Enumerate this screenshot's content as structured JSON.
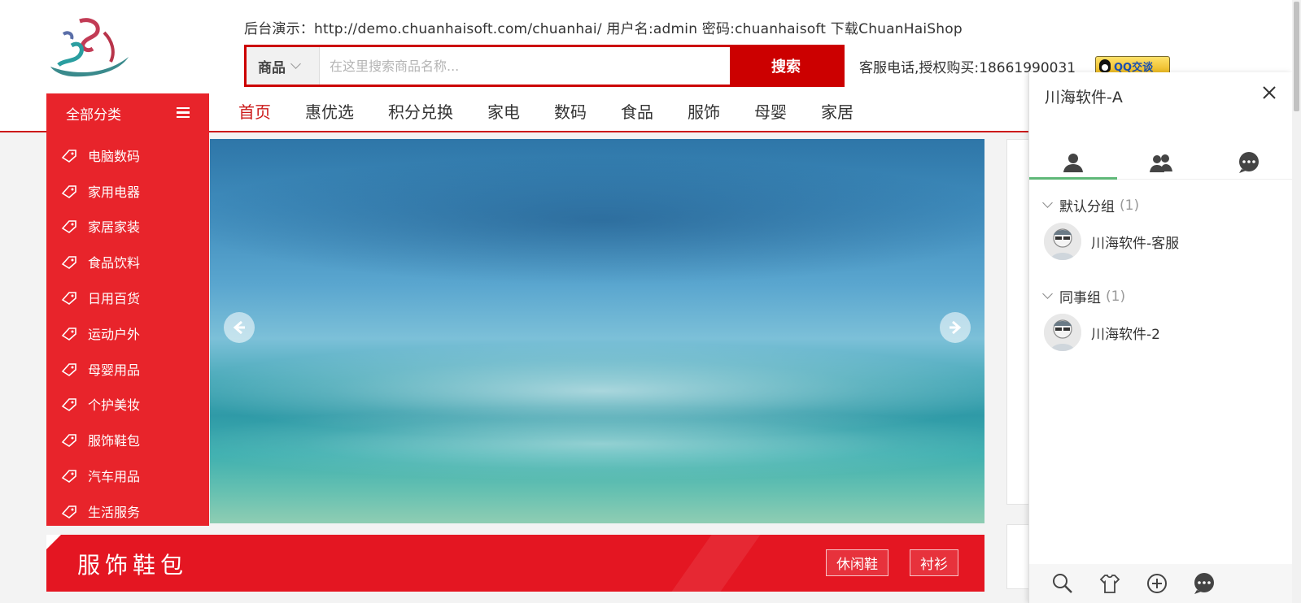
{
  "header": {
    "notice": "后台演示：http://demo.chuanhaisoft.com/chuanhai/ 用户名:admin 密码:chuanhaisoft 下载ChuanHaiShop",
    "search": {
      "category": "商品",
      "placeholder": "在这里搜索商品名称...",
      "button": "搜索"
    },
    "hotline": "客服电话,授权购买:18661990031",
    "qq_badge": "QQ交谈"
  },
  "all_categories": "全部分类",
  "nav": [
    "首页",
    "惠优选",
    "积分兑换",
    "家电",
    "数码",
    "食品",
    "服饰",
    "母婴",
    "家居"
  ],
  "categories": [
    "电脑数码",
    "家用电器",
    "家居家装",
    "食品饮料",
    "日用百货",
    "运动户外",
    "母婴用品",
    "个护美妆",
    "服饰鞋包",
    "汽车用品",
    "生活服务"
  ],
  "section": {
    "title": "服饰鞋包",
    "tags": [
      "休闲鞋",
      "衬衫"
    ]
  },
  "chat": {
    "title": "川海软件-A",
    "groups": [
      {
        "name": "默认分组",
        "count": "(1)",
        "contact": "川海软件-客服"
      },
      {
        "name": "同事组",
        "count": "(1)",
        "contact": "川海软件-2"
      }
    ]
  },
  "colors": {
    "brand_red": "#e8242b",
    "search_red": "#cc0000",
    "tab_active": "#5fb878"
  },
  "icons": {
    "nav_arrows": [
      "arrow-left-icon",
      "arrow-right-icon"
    ],
    "chat_tabs": [
      "user-icon",
      "group-icon",
      "chat-bubble-icon"
    ],
    "chat_footer": [
      "search-icon",
      "skin-icon",
      "add-icon",
      "message-icon"
    ]
  }
}
